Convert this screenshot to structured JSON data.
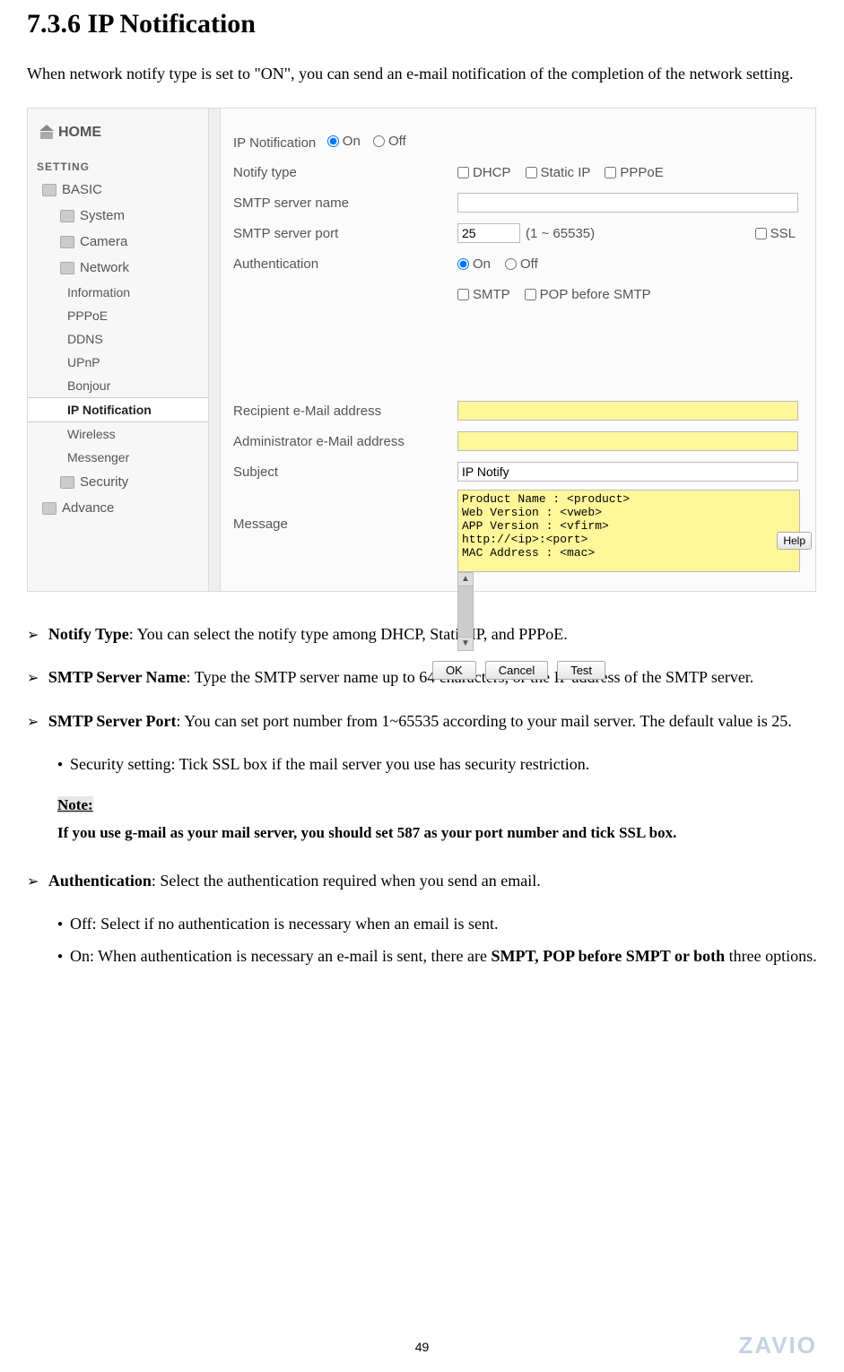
{
  "heading": "7.3.6 IP Notification",
  "intro": "When network notify type is set to \"ON\", you can send an e-mail notification of the completion of the network setting.",
  "sidebar": {
    "home": "HOME",
    "setting_header": "SETTING",
    "basic": "BASIC",
    "items": {
      "system": "System",
      "camera": "Camera",
      "network": "Network"
    },
    "network_sub": {
      "information": "Information",
      "pppoe": "PPPoE",
      "ddns": "DDNS",
      "upnp": "UPnP",
      "bonjour": "Bonjour",
      "ipnotification": "IP Notification",
      "wireless": "Wireless",
      "messenger": "Messenger"
    },
    "security": "Security",
    "advance": "Advance"
  },
  "panel": {
    "ip_notification_label": "IP Notification",
    "on": "On",
    "off": "Off",
    "notify_type_label": "Notify type",
    "dhcp": "DHCP",
    "static_ip": "Static IP",
    "pppoe": "PPPoE",
    "smtp_server_name_label": "SMTP server name",
    "smtp_server_port_label": "SMTP server port",
    "smtp_server_port_value": "25",
    "smtp_port_range": "(1 ~ 65535)",
    "ssl": "SSL",
    "authentication_label": "Authentication",
    "smtp": "SMTP",
    "pop_before_smtp": "POP before SMTP",
    "recipient_label": "Recipient e-Mail address",
    "admin_label": "Administrator e-Mail address",
    "subject_label": "Subject",
    "subject_value": "IP Notify",
    "message_label": "Message",
    "message_value": "Product Name : <product>\nWeb Version : <vweb>\nAPP Version : <vfirm>\nhttp://<ip>:<port>\nMAC Address : <mac>",
    "ok": "OK",
    "cancel": "Cancel",
    "test": "Test",
    "help": "Help"
  },
  "prose": {
    "notify_type_b": "Notify Type",
    "notify_type": ": You can select the notify type among DHCP, Static IP, and PPPoE.",
    "smtp_name_b": "SMTP Server Name",
    "smtp_name": ": Type the SMTP server name up to 64 characters, or the IP address of the SMTP server.",
    "smtp_port_b": "SMTP Server Port",
    "smtp_port": ": You can set port number from 1~65535 according to your mail server. The default value is 25.",
    "security_setting": "Security setting: Tick SSL box if the mail server you use has security restriction.",
    "note_label": "Note:",
    "note_body": "If you use g-mail as your mail server, you should set 587 as your port number and tick SSL box.",
    "auth_b": "Authentication",
    "auth": ": Select the authentication required when you send an email.",
    "auth_off": "Off: Select if no authentication is necessary when an email is sent.",
    "auth_on_pre": "On: When authentication is necessary an e-mail is sent, there are ",
    "auth_on_bold": "SMPT, POP before SMPT or both",
    "auth_on_post": " three options."
  },
  "page_number": "49",
  "brand": "ZAVIO"
}
